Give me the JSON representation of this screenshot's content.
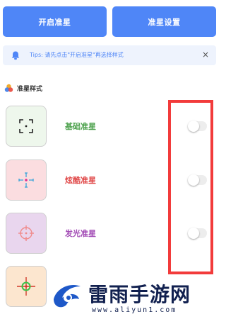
{
  "toolbar": {
    "open_label": "开启准星",
    "settings_label": "准星设置"
  },
  "tips": {
    "text": "Tips: 请先点击\"开启准星\"再选择样式",
    "close_glyph": "×",
    "bell_icon": "bell-icon"
  },
  "section": {
    "title": "准星样式",
    "logo_icon": "color-dots-icon"
  },
  "crosshairs": [
    {
      "label": "基础准星",
      "color": "#4ea24e",
      "thumb_bg": "#eef7ec",
      "enabled": false
    },
    {
      "label": "炫酷准星",
      "color": "#e04848",
      "thumb_bg": "#fbdde0",
      "enabled": false
    },
    {
      "label": "发光准星",
      "color": "#a24bb5",
      "thumb_bg": "#e9d6ee",
      "enabled": false
    },
    {
      "label": "",
      "color": "#e8603a",
      "thumb_bg": "#fce6cf",
      "enabled": false
    }
  ],
  "watermark": {
    "name": "雷雨手游网",
    "url": "www.aliyun1.com"
  },
  "colors": {
    "accent": "#4f86f7",
    "tips_bg": "#eef3fd",
    "highlight_frame": "#f23b3b"
  }
}
